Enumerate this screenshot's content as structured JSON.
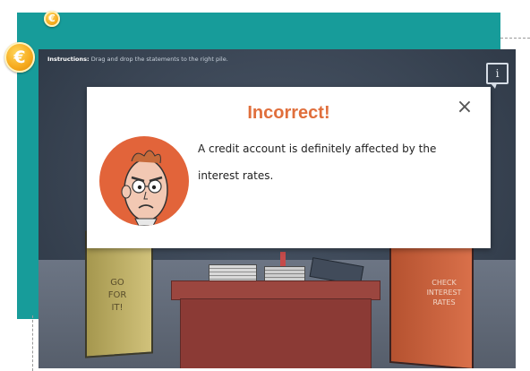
{
  "badges": {
    "coin_top": "€",
    "coin_left": "€"
  },
  "activity": {
    "instructions_label": "Instructions:",
    "instructions_text": "Drag and drop the statements to the right pile.",
    "corner_icon": "i"
  },
  "piles": {
    "left": [
      "GO",
      "FOR",
      "IT!"
    ],
    "right": [
      "CHECK",
      "INTEREST",
      "RATES"
    ]
  },
  "feedback": {
    "title": "Incorrect!",
    "close_icon": "×",
    "message": "A credit account is definitely affected by the interest rates."
  },
  "colors": {
    "teal": "#179c9a",
    "title_orange": "#e06f3c",
    "avatar_bg": "#e2643a",
    "coin_gold": "#f6a91c"
  }
}
